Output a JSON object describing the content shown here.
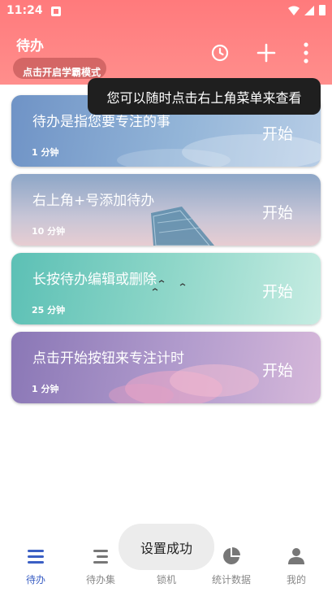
{
  "status_bar": {
    "time": "11:24"
  },
  "header": {
    "title": "待办",
    "mode_chip_label": "点击开启学霸模式",
    "actions": [
      "clock-icon",
      "add-icon",
      "more-vert-icon"
    ]
  },
  "tooltip": {
    "text": "您可以随时点击右上角菜单来查看"
  },
  "todos": [
    {
      "name": "待办是指您要专注的事",
      "duration": "1 分钟",
      "start_label": "开始"
    },
    {
      "name": "右上角+号添加待办",
      "duration": "10 分钟",
      "start_label": "开始"
    },
    {
      "name": "长按待办编辑或删除",
      "duration": "25 分钟",
      "start_label": "开始"
    },
    {
      "name": "点击开始按钮来专注计时",
      "duration": "1 分钟",
      "start_label": "开始"
    }
  ],
  "toast": {
    "text": "设置成功"
  },
  "bottom_nav": [
    {
      "label": "待办",
      "icon": "todo-list-icon",
      "active": true
    },
    {
      "label": "待办集",
      "icon": "todo-set-icon",
      "active": false
    },
    {
      "label": "锁机",
      "icon": "lock-phone-icon",
      "active": false
    },
    {
      "label": "统计数据",
      "icon": "pie-chart-icon",
      "active": false
    },
    {
      "label": "我的",
      "icon": "person-icon",
      "active": false
    }
  ],
  "colors": {
    "header": "#ff7a7c",
    "accent": "#3b5fc4",
    "tooltip_bg": "#1f1f1f",
    "toast_bg": "#ececec"
  }
}
